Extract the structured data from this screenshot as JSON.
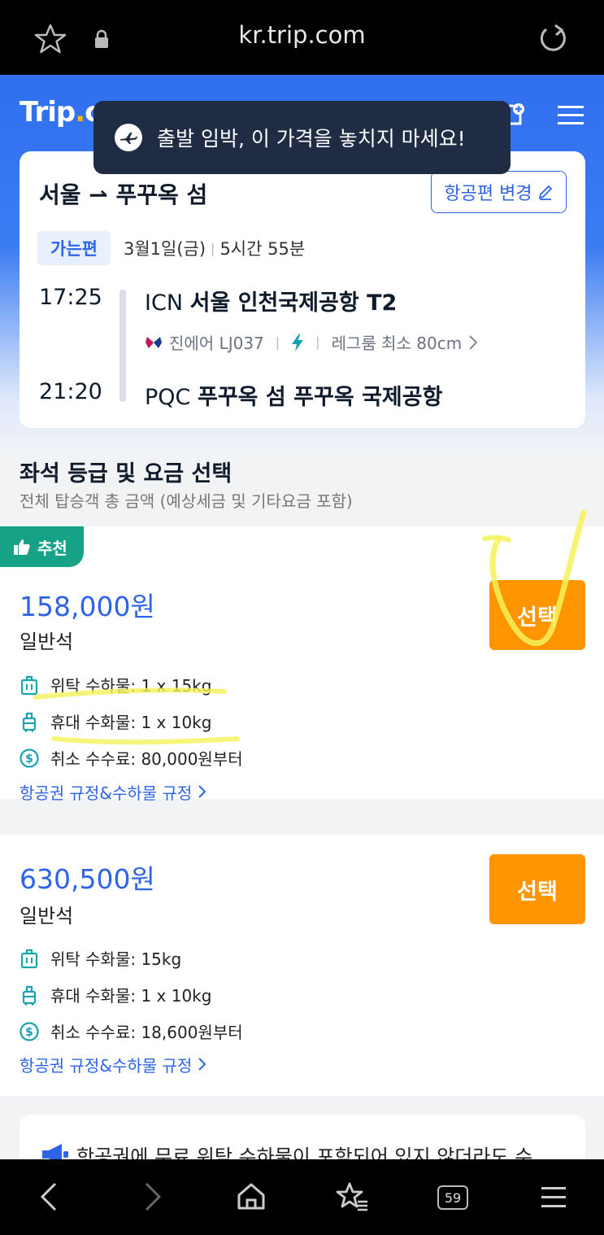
{
  "browser": {
    "url": "kr.trip.com",
    "tabs_count": "59"
  },
  "header": {
    "logo_main": "Trip",
    "logo_dot": ".",
    "logo_suffix": "com"
  },
  "toast": {
    "message": "출발 임박, 이 가격을 놓치지 마세요!"
  },
  "flight": {
    "route": "서울 ⇀ 푸꾸옥 섬",
    "change_label": "항공편 변경",
    "leg_label": "가는편",
    "date": "3월1일(금)",
    "duration": "5시간 55분",
    "depart_time": "17:25",
    "depart_code": "ICN",
    "depart_airport": "서울 인천국제공항 T2",
    "airline": "진에어 LJ037",
    "legroom": "레그룸 최소 80cm",
    "arrive_time": "21:20",
    "arrive_code": "PQC",
    "arrive_airport": "푸꾸옥 섬 푸꾸옥 국제공항"
  },
  "section": {
    "title": "좌석 등급 및 요금 선택",
    "subtitle": "전체 탑승객 총 금액 (예상세금 및 기타요금 포함)"
  },
  "fares": [
    {
      "badge": "추천",
      "price": "158,000원",
      "cabin": "일반석",
      "select_label": "선택",
      "checked_bag": "위탁 수하물: 1 x 15kg",
      "carry_on": "휴대 수화물: 1 x 10kg",
      "cancel_fee": "취소 수수료: 80,000원부터",
      "rules_link": "항공권 규정&수하물 규정"
    },
    {
      "price": "630,500원",
      "cabin": "일반석",
      "select_label": "선택",
      "checked_bag": "위탁 수화물: 15kg",
      "carry_on": "휴대 수화물: 1 x 10kg",
      "cancel_fee": "취소 수수료: 18,600원부터",
      "rules_link": "항공권 규정&수하물 규정"
    }
  ],
  "notice": {
    "text": "항공권에 무료 위탁 수하물이 포함되어 있지 않더라도 수"
  },
  "colors": {
    "brand_blue": "#2e64e8",
    "select_orange": "#ff9500",
    "recommend_green": "#16a287",
    "highlighter": "#f4f25a"
  }
}
